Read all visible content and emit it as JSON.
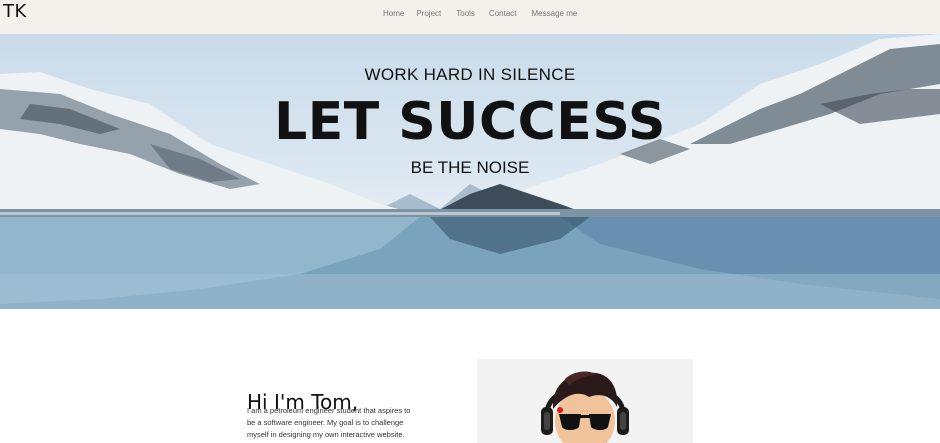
{
  "brand": "TK",
  "nav": {
    "items": [
      {
        "label": "Home"
      },
      {
        "label": "Project"
      },
      {
        "label": "Tools"
      },
      {
        "label": "Contact"
      },
      {
        "label": "Message me"
      }
    ]
  },
  "hero": {
    "kicker": "WORK HARD IN SILENCE",
    "headline": "LET SUCCESS",
    "subline": "BE THE NOISE"
  },
  "about": {
    "title": "Hi I'm Tom,",
    "lines": [
      "I am a petroleum engineer student that aspires to",
      "be a software engineer. My goal is to challenge",
      "myself in designing my own interactive website."
    ]
  },
  "colors": {
    "navbar_bg": "#f4f1ed",
    "nav_text": "#777777",
    "avatar_card_bg": "#f3f3f3"
  }
}
